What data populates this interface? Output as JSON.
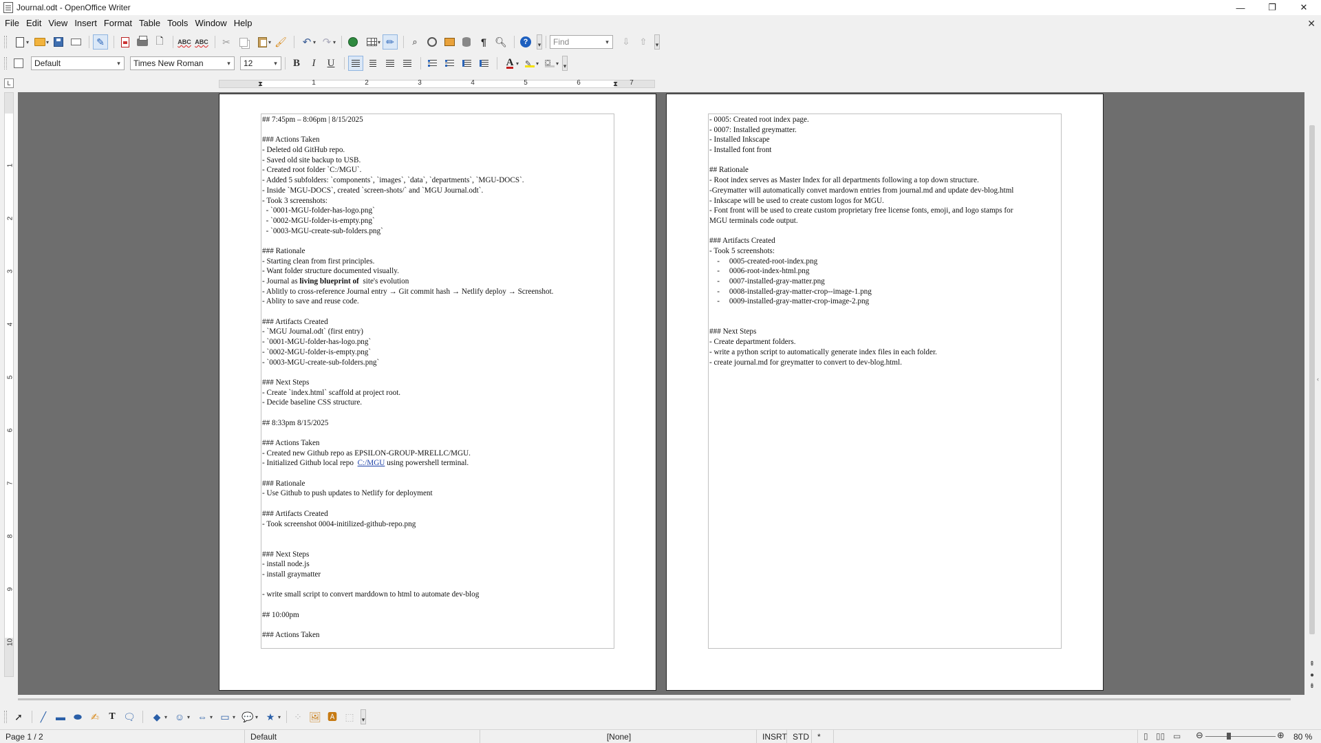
{
  "window": {
    "title": "Journal.odt - OpenOffice Writer",
    "controls": {
      "minimize": "—",
      "maximize": "❐",
      "close": "✕"
    }
  },
  "menubar": {
    "items": [
      "File",
      "Edit",
      "View",
      "Insert",
      "Format",
      "Table",
      "Tools",
      "Window",
      "Help"
    ],
    "close_glyph": "✕"
  },
  "formatting": {
    "paragraph_style": "Default",
    "font_name": "Times New Roman",
    "font_size": "12",
    "bold": "B",
    "italic": "I",
    "underline": "U",
    "font_color_glyph": "A",
    "font_color": "#c21b1b",
    "highlight_color": "#f5e100"
  },
  "find": {
    "placeholder": "Find"
  },
  "ruler": {
    "tab_glyph": "L",
    "h_numbers": [
      "1",
      "2",
      "3",
      "4",
      "5",
      "6",
      "7"
    ],
    "v_numbers": [
      "1",
      "2",
      "3",
      "4",
      "5",
      "6",
      "7",
      "8",
      "9",
      "10"
    ]
  },
  "document": {
    "page1": [
      "## 7:45pm – 8:06pm | 8/15/2025",
      "",
      "### Actions Taken",
      "- Deleted old GitHub repo.",
      "- Saved old site backup to USB.",
      "- Created root folder `C:/MGU`.",
      "- Added 5 subfolders: `components`, `images`, `data`, `departments`, `MGU-DOCS`.",
      "- Inside `MGU-DOCS`, created `screen-shots/` and `MGU Journal.odt`.",
      "- Took 3 screenshots:",
      "  - `0001-MGU-folder-has-logo.png`",
      "  - `0002-MGU-folder-is-empty.png`",
      "  - `0003-MGU-create-sub-folders.png`",
      "",
      "### Rationale",
      "- Starting clean from first principles.",
      "- Want folder structure documented visually.",
      "- Journal as living blueprint of  site's evolution",
      "- Ablitly to cross-reference Journal entry → Git commit hash → Netlify deploy → Screenshot.",
      "- Ablity to save and reuse code.",
      "",
      "### Artifacts Created",
      "- `MGU Journal.odt` (first entry)",
      "- `0001-MGU-folder-has-logo.png`",
      "- `0002-MGU-folder-is-empty.png`",
      "- `0003-MGU-create-sub-folders.png`",
      "",
      "### Next Steps",
      "- Create `index.html` scaffold at project root.",
      "- Decide baseline CSS structure.",
      "",
      "## 8:33pm 8/15/2025",
      "",
      "### Actions Taken",
      "- Created new Github repo as EPSILON-GROUP-MRELLC/MGU.",
      "- Initialized Github local repo  C:/MGU using powershell terminal.",
      "",
      "### Rationale",
      "- Use Github to push updates to Netlify for deployment",
      "",
      "### Artifacts Created",
      "- Took screenshot 0004-initilized-github-repo.png",
      "",
      "",
      "### Next Steps",
      "- install node.js",
      "- install graymatter",
      "",
      "- write small script to convert marddown to html to automate dev-blog",
      "",
      "## 10:00pm",
      "",
      "### Actions Taken"
    ],
    "page1_bold_phrase": "living blueprint of",
    "page1_link": "C:/MGU",
    "page2": [
      "- 0005: Created root index page.",
      "- 0007: Installed greymatter.",
      "- Installed Inkscape",
      "- Installed font front",
      "",
      "## Rationale",
      "- Root index serves as Master Index for all departments following a top down structure.",
      "-Greymatter will automatically convet mardown entries from journal.md and update dev-blog.html",
      "- Inkscape will be used to create custom logos for MGU.",
      "- Font front will be used to create custom proprietary free license fonts, emoji, and logo stamps for",
      "MGU terminals code output.",
      "",
      "### Artifacts Created",
      "- Took 5 screenshots:",
      "    -     0005-created-root-index.png",
      "    -     0006-root-index-html.png",
      "    -     0007-installed-gray-matter.png",
      "    -     0008-installed-gray-matter-crop--image-1.png",
      "    -     0009-installed-gray-matter-crop-image-2.png",
      "",
      "",
      "### Next Steps",
      "- Create department folders.",
      "- write a python script to automatically generate index files in each folder.",
      "- create journal.md for greymatter to convert to dev-blog.html."
    ]
  },
  "statusbar": {
    "page": "Page 1 / 2",
    "style": "Default",
    "language": "[None]",
    "insert_mode": "INSRT",
    "selection_mode": "STD",
    "modified": "*",
    "zoom": "80 %"
  }
}
